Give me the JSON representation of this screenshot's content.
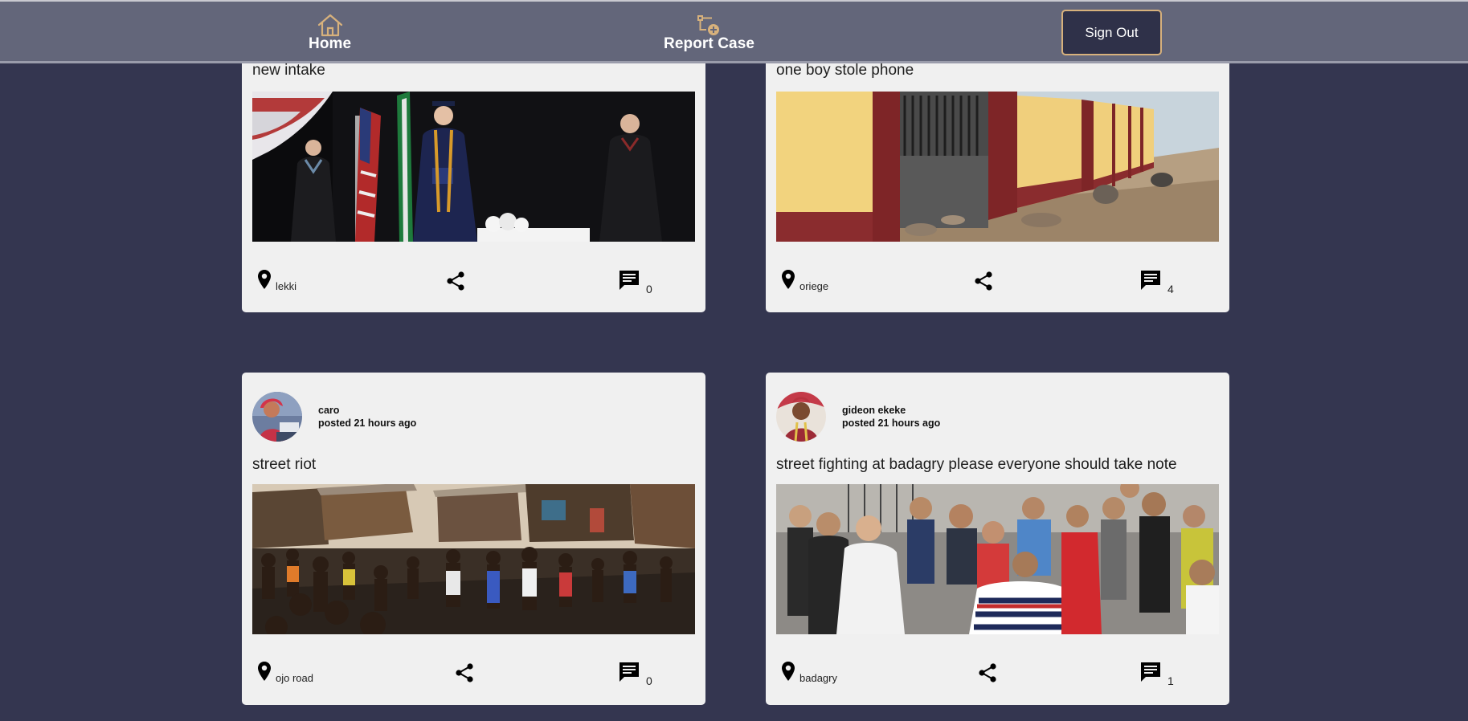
{
  "nav": {
    "home_label": "Home",
    "report_label": "Report Case",
    "signout_label": "Sign Out",
    "accent_color": "#d7b17c"
  },
  "posts": [
    {
      "title": "new intake",
      "location": "lekki",
      "comment_count": "0",
      "image": "graduation-ceremony-photo"
    },
    {
      "title": "one boy stole phone",
      "location": "oriege",
      "comment_count": "4",
      "image": "walled-street-photo"
    },
    {
      "author": "caro",
      "posted": "posted 21 hours ago",
      "title": "street riot",
      "location": "ojo road",
      "comment_count": "0",
      "image": "crowd-in-slum-photo"
    },
    {
      "author": "gideon ekeke",
      "posted": "posted 21 hours ago",
      "title": "street fighting at badagry please everyone should take note",
      "location": "badagry",
      "comment_count": "1",
      "image": "street-fight-photo"
    }
  ],
  "icons": {
    "home": "house-icon",
    "report": "report-case-icon",
    "location": "location-pin-icon",
    "share": "share-icon",
    "comment": "comment-icon"
  }
}
